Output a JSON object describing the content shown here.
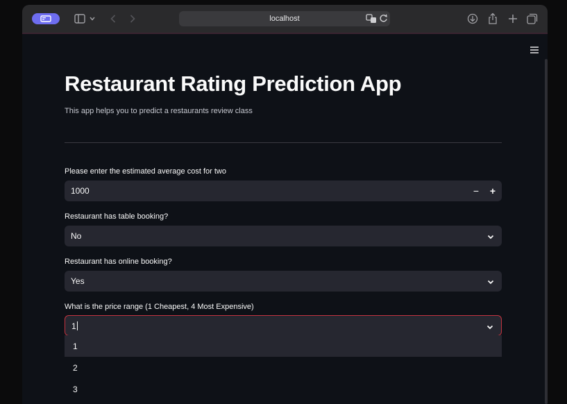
{
  "browser": {
    "url": "localhost"
  },
  "app": {
    "title": "Restaurant Rating Prediction App",
    "subtitle": "This app helps you to predict a restaurants review class"
  },
  "form": {
    "cost": {
      "label": "Please enter the estimated average cost for two",
      "value": "1000",
      "minus": "−",
      "plus": "+"
    },
    "table_booking": {
      "label": "Restaurant has table booking?",
      "value": "No"
    },
    "online_booking": {
      "label": "Restaurant has online booking?",
      "value": "Yes"
    },
    "price_range": {
      "label": "What is the price range (1 Cheapest, 4 Most Expensive)",
      "value": "1",
      "options": [
        "1",
        "2",
        "3"
      ]
    }
  },
  "colors": {
    "accent": "#6e6df0",
    "focus_border": "#c4333f",
    "field_bg": "#262730",
    "page_bg": "#0e1117"
  }
}
